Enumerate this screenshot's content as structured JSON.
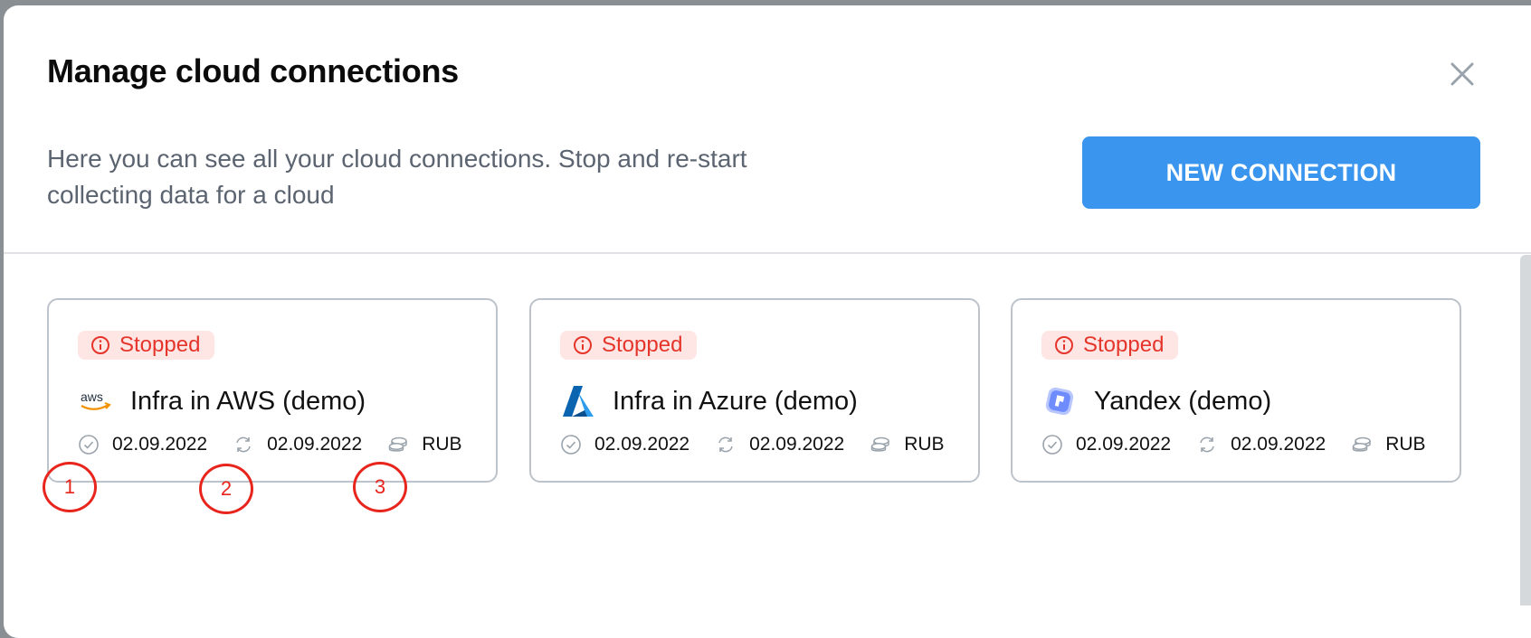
{
  "dialog": {
    "title": "Manage cloud connections",
    "description": "Here you can see all your cloud connections. Stop and re-start collecting data for a cloud",
    "new_button_label": "NEW CONNECTION",
    "close_icon": "close-icon"
  },
  "connections": [
    {
      "status": "Stopped",
      "name": "Infra in AWS (demo)",
      "logo": "aws-logo",
      "connected_date": "02.09.2022",
      "last_sync_date": "02.09.2022",
      "currency": "RUB"
    },
    {
      "status": "Stopped",
      "name": "Infra in Azure (demo)",
      "logo": "azure-logo",
      "connected_date": "02.09.2022",
      "last_sync_date": "02.09.2022",
      "currency": "RUB"
    },
    {
      "status": "Stopped",
      "name": "Yandex (demo)",
      "logo": "yandex-cloud-logo",
      "connected_date": "02.09.2022",
      "last_sync_date": "02.09.2022",
      "currency": "RUB"
    }
  ],
  "annotations": [
    "1",
    "2",
    "3"
  ],
  "colors": {
    "accent": "#3a95ef",
    "status_stopped": "#e5352b",
    "status_stopped_bg": "#fde6e4"
  }
}
